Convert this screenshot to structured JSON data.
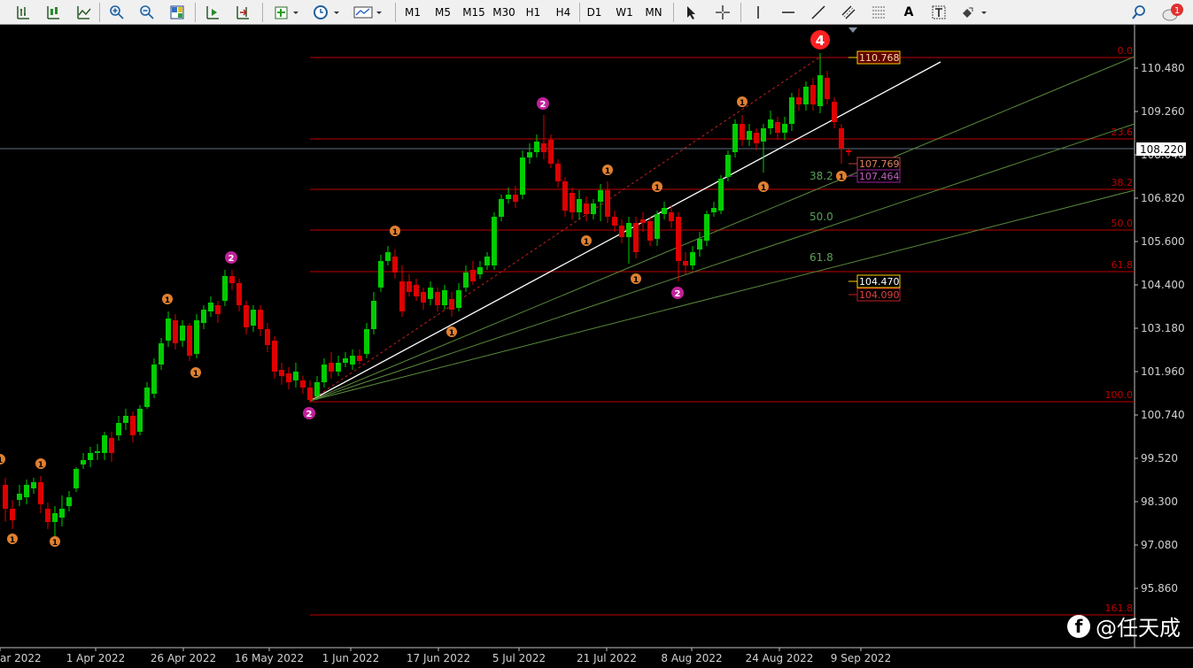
{
  "toolbar": {
    "timeframes": [
      "M1",
      "M5",
      "M15",
      "M30",
      "H1",
      "H4",
      "D1",
      "W1",
      "MN"
    ],
    "tools": [
      "bar-chart-icon",
      "candlestick-icon",
      "line-chart-icon",
      "zoom-in-icon",
      "zoom-out-icon",
      "tile-windows-icon",
      "autoscroll-icon",
      "chart-shift-icon",
      "indicators-icon",
      "period-clock-icon",
      "templates-icon",
      "cursor-icon",
      "crosshair-icon",
      "vertical-line-icon",
      "horizontal-line-icon",
      "trendline-icon",
      "equidistant-channel-icon",
      "fibonacci-icon",
      "text-icon",
      "text-label-icon",
      "arrows-icon",
      "search-icon",
      "notification-icon"
    ],
    "text_tool": "A",
    "notification_count": "1"
  },
  "price_axis": {
    "labels": [
      "110.480",
      "109.260",
      "108.040",
      "106.820",
      "105.600",
      "104.400",
      "103.180",
      "101.960",
      "100.740",
      "99.520",
      "98.300",
      "97.080",
      "95.860"
    ],
    "current_price": "108.220"
  },
  "time_axis": {
    "labels": [
      "ar 2022",
      "1 Apr 2022",
      "26 Apr 2022",
      "16 May 2022",
      "1 Jun 2022",
      "17 Jun 2022",
      "5 Jul 2022",
      "21 Jul 2022",
      "8 Aug 2022",
      "24 Aug 2022",
      "9 Sep 2022"
    ]
  },
  "fib_levels": {
    "right_labels": [
      "0.0",
      "23.6",
      "38.2",
      "50.0",
      "61.8",
      "100.0",
      "161.8"
    ],
    "fan_labels": [
      "38.2",
      "50.0",
      "61.8"
    ]
  },
  "price_tags": {
    "top": "110.768",
    "tag_1": "107.769",
    "tag_2": "107.464",
    "tag_3": "104.470",
    "tag_4": "104.090"
  },
  "wave_marks": {
    "major": "4",
    "minor1": "1",
    "minor2": "2"
  },
  "watermark": {
    "name": "@任天成"
  },
  "colors": {
    "bull": "#00cc00",
    "bear": "#dd0000",
    "fib_line": "#c00000",
    "fan_line": "#5a8a3c",
    "wave1": "#e08030",
    "wave2": "#c0209a",
    "wave4": "#ff2020"
  }
}
